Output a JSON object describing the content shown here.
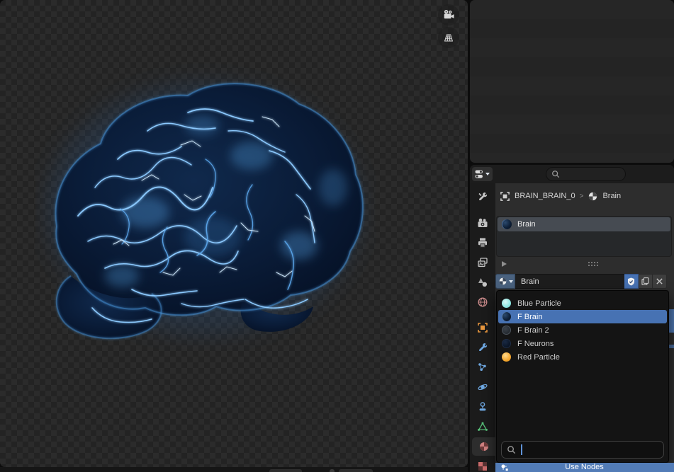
{
  "colors": {
    "accent": "#4772b3",
    "selected_row": "#4772b3",
    "panel_bg": "#2d2d2d",
    "header_bg": "#1c1c1c",
    "dropdown_bg": "#141414",
    "checker_dark": "#232323",
    "checker_light": "#2b2b2b",
    "brain_glow": "#7cc4ff",
    "use_nodes_bg": "#527cb7"
  },
  "viewport": {
    "gizmos": [
      {
        "icon": "camera-view-icon"
      },
      {
        "icon": "grid-floor-icon"
      }
    ]
  },
  "properties": {
    "header": {
      "editor_type_icon": "properties-editor-icon",
      "search_placeholder": ""
    },
    "breadcrumb": {
      "object_name": "BRAIN_BRAIN_0",
      "separator": ">",
      "data_name": "Brain"
    },
    "tabs": [
      "tool",
      "render",
      "output",
      "view-layer",
      "scene",
      "world",
      "object",
      "modifiers",
      "particles",
      "physics",
      "constraints",
      "object-data",
      "material",
      "texture"
    ],
    "active_tab": "material",
    "slots": {
      "items": [
        "Brain"
      ]
    },
    "datablock": {
      "name": "Brain",
      "fake_user_on": true
    },
    "material_list": {
      "items": [
        {
          "label": "Blue Particle",
          "icon": "material-preview-cyan"
        },
        {
          "label": "F Brain",
          "icon": "material-preview-dark-blue"
        },
        {
          "label": "F Brain 2",
          "icon": "material-preview-grey"
        },
        {
          "label": "F Neurons",
          "icon": "material-preview-navy"
        },
        {
          "label": "Red Particle",
          "icon": "material-preview-orange"
        }
      ],
      "selected": "F Brain",
      "search_value": ""
    },
    "use_nodes": {
      "label": "Use Nodes"
    }
  }
}
